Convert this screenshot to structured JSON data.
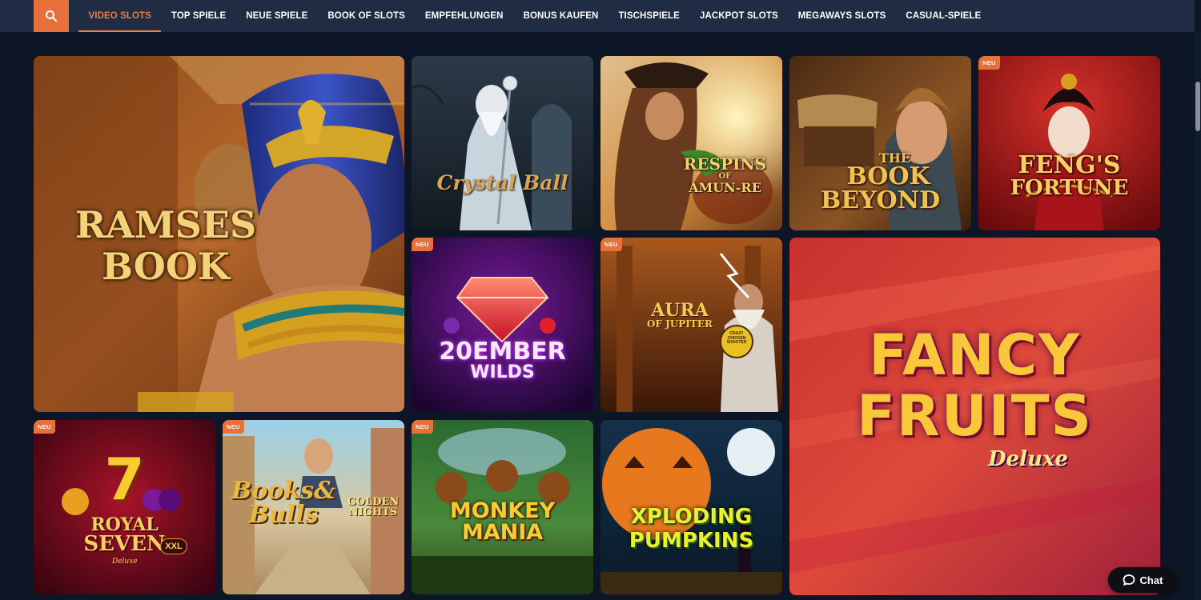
{
  "nav": {
    "search_icon": "search-icon",
    "items": [
      {
        "label": "VIDEO SLOTS",
        "active": true
      },
      {
        "label": "TOP SPIELE"
      },
      {
        "label": "NEUE SPIELE"
      },
      {
        "label": "BOOK OF SLOTS"
      },
      {
        "label": "EMPFEHLUNGEN"
      },
      {
        "label": "BONUS KAUFEN"
      },
      {
        "label": "TISCHSPIELE"
      },
      {
        "label": "JACKPOT SLOTS"
      },
      {
        "label": "MEGAWAYS SLOTS"
      },
      {
        "label": "CASUAL-SPIELE"
      }
    ]
  },
  "games": {
    "ramses": {
      "title_line1": "RAMSES",
      "title_line2": "BOOK"
    },
    "crystal": {
      "title": "Crystal Ball"
    },
    "respins": {
      "title_line1": "RESPINS",
      "title_line2": "OF",
      "title_line3": "AMUN-RE"
    },
    "book_beyond": {
      "title_line1": "THE",
      "title_line2": "BOOK",
      "title_line3": "BEYOND"
    },
    "fengs": {
      "badge": "NEU",
      "title_line1": "FENG'S",
      "title_line2": "FORTUNE"
    },
    "ember": {
      "badge": "NEU",
      "title_line1": "20EMBER",
      "title_line2": "WILDS"
    },
    "aura": {
      "badge": "NEU",
      "title_line1": "AURA",
      "title_line2": "OF JUPITER",
      "sticker": "CRAZY CHICKEN SHOOTER"
    },
    "fancy": {
      "title_line1": "FANCY",
      "title_line2": "FRUITS",
      "title_line3": "Deluxe"
    },
    "royal": {
      "badge": "NEU",
      "seven": "7",
      "title_line1": "ROYAL",
      "title_line2": "SEVEN",
      "title_line3": "Deluxe",
      "xxl": "XXL"
    },
    "books_bulls": {
      "badge": "NEU",
      "title_line1": "Books&",
      "title_line2": "Bulls",
      "sub_line1": "GOLDEN",
      "sub_line2": "NIGHTS"
    },
    "monkey": {
      "badge": "NEU",
      "title_line1": "MONKEY",
      "title_line2": "MANIA"
    },
    "pumpkins": {
      "title_line1": "XPLODING",
      "title_line2": "PUMPKINS"
    }
  },
  "chat": {
    "label": "Chat",
    "icon": "chat-bubble-icon"
  },
  "colors": {
    "accent": "#e8703a",
    "nav_bg": "#1f2c43",
    "page_bg": "#0d1626"
  }
}
